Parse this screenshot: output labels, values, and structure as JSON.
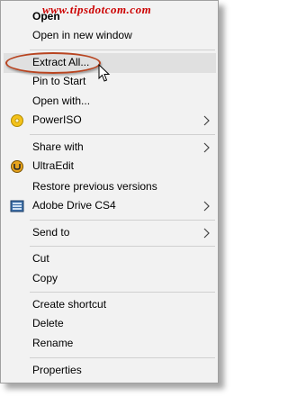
{
  "watermark": "www.tipsdotcom.com",
  "menu": {
    "items": [
      {
        "label": "Open"
      },
      {
        "label": "Open in new window"
      },
      {
        "label": "Extract All..."
      },
      {
        "label": "Pin to Start"
      },
      {
        "label": "Open with..."
      },
      {
        "label": "PowerISO",
        "icon": "poweriso-icon"
      },
      {
        "label": "Share with"
      },
      {
        "label": "UltraEdit",
        "icon": "ultraedit-icon"
      },
      {
        "label": "Restore previous versions"
      },
      {
        "label": "Adobe Drive CS4",
        "icon": "adobe-drive-icon"
      },
      {
        "label": "Send to"
      },
      {
        "label": "Cut"
      },
      {
        "label": "Copy"
      },
      {
        "label": "Create shortcut"
      },
      {
        "label": "Delete"
      },
      {
        "label": "Rename"
      },
      {
        "label": "Properties"
      }
    ]
  },
  "colors": {
    "menu_bg": "#f2f2f2",
    "highlight": "#e0e0e0",
    "annotation_oval": "#b84420",
    "watermark": "#cc0000"
  }
}
